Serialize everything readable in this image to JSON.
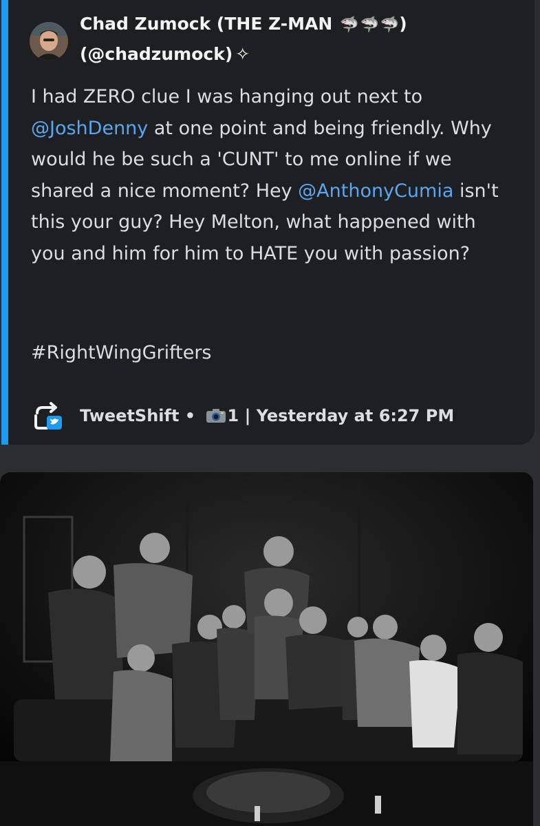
{
  "embed": {
    "accent_color": "#1d9bf0",
    "author": {
      "name": "Chad Zumock (THE Z-MAN",
      "name_close": ")",
      "name_emoji": "shark-icon x3",
      "handle": "(@chadzumock)",
      "handle_badge": "sparkle-icon"
    },
    "tweet": {
      "seg1": "I had ZERO clue I was hanging out next to ",
      "mention1": "@JoshDenny",
      "seg2": " at one point and being friendly. Why would he be such a 'CUNT' to me online if we shared a nice moment? Hey ",
      "mention2": "@AnthonyCumia",
      "seg3": " isn't this your guy? Hey Melton, what happened with you and him for him to HATE you with passion?",
      "hashtag": "#RightWingGrifters"
    },
    "footer": {
      "source": "TweetShift",
      "separator": " • ",
      "media_icon": "camera-icon",
      "media_count": "1",
      "divider": " | ",
      "timestamp": "Yesterday at 6:27 PM"
    }
  },
  "photo": {
    "description_icon": "group-photo",
    "style": "black-and-white"
  }
}
